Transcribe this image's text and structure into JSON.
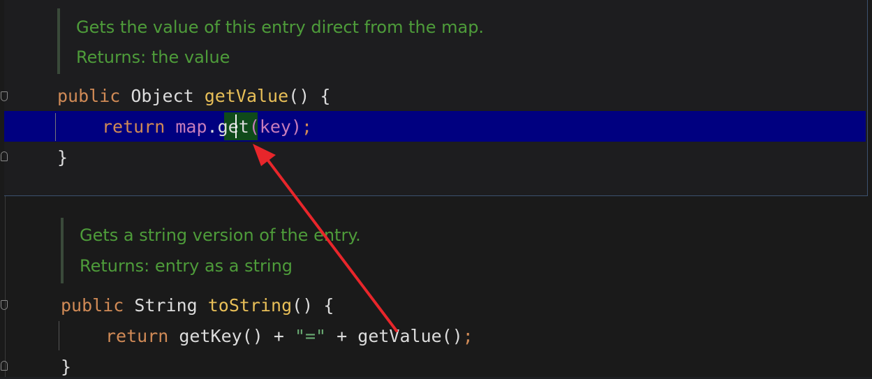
{
  "popup": {
    "doc_lines": [
      "Gets the value of this entry direct from the map.",
      "Returns: the value"
    ],
    "code": {
      "line1": {
        "kw": "public",
        "type": "Object",
        "method": "getValue",
        "rest": "() {"
      },
      "line2": {
        "kw": "return",
        "obj": "map",
        "dot": ".",
        "method_a": "g",
        "method_b": "et",
        "args": "(key)",
        "semi": ";"
      },
      "line3": {
        "brace": "}"
      }
    }
  },
  "editor": {
    "doc_lines": [
      "Gets a string version of the entry.",
      "Returns: entry as a string"
    ],
    "code": {
      "line1": {
        "kw": "public",
        "type": "String",
        "method": "toString",
        "rest": "() {"
      },
      "line2": {
        "kw": "return",
        "call1": "getKey()",
        "plus1": " + ",
        "str": "\"=\"",
        "plus2": " + ",
        "call2": "getValue()",
        "semi": ";"
      },
      "line3": {
        "brace": "}"
      }
    }
  },
  "colors": {
    "selection": "#000080",
    "word_highlight": "#0f4a1a",
    "doc_text": "#4e9c3a",
    "keyword": "#d08a56",
    "method": "#e8bf58",
    "arrow": "#e8262b"
  }
}
